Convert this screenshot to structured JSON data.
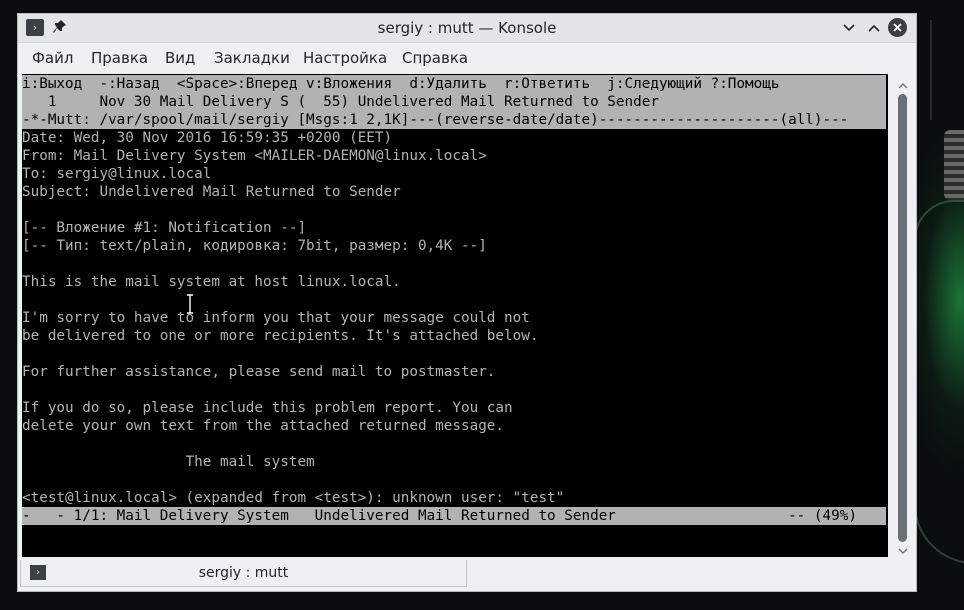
{
  "window": {
    "title": "sergiy : mutt — Konsole",
    "accent": "#3daee9"
  },
  "menubar": {
    "items": [
      "Файл",
      "Правка",
      "Вид",
      "Закладки",
      "Настройка",
      "Справка"
    ]
  },
  "terminal": {
    "help_line": "i:Выход  -:Назад  <Space>:Вперед v:Вложения  d:Удалить  r:Ответить  j:Следующий ?:Помощь",
    "index_line": "   1     Nov 30 Mail Delivery S (  55) Undelivered Mail Returned to Sender",
    "index_status": "-*-Mutt: /var/spool/mail/sergiy [Msgs:1 2,1K]---(reverse-date/date)---------------------(all)---",
    "lines": [
      "Date: Wed, 30 Nov 2016 16:59:35 +0200 (EET)",
      "From: Mail Delivery System <MAILER-DAEMON@linux.local>",
      "To: sergiy@linux.local",
      "Subject: Undelivered Mail Returned to Sender",
      "",
      "[-- Вложение #1: Notification --]",
      "[-- Тип: text/plain, кодировка: 7bit, размер: 0,4K --]",
      "",
      "This is the mail system at host linux.local.",
      "",
      "I'm sorry to have to inform you that your message could not",
      "be delivered to one or more recipients. It's attached below.",
      "",
      "For further assistance, please send mail to postmaster.",
      "",
      "If you do so, please include this problem report. You can",
      "delete your own text from the attached returned message.",
      "",
      "                   The mail system",
      "",
      "<test@linux.local> (expanded from <test>): unknown user: \"test\""
    ],
    "pager_status": "-   - 1/1: Mail Delivery System   Undelivered Mail Returned to Sender                    -- (49%)"
  },
  "scrollbar": {
    "position_fraction": 1.0
  },
  "tabs": [
    {
      "label": "sergiy : mutt"
    }
  ]
}
